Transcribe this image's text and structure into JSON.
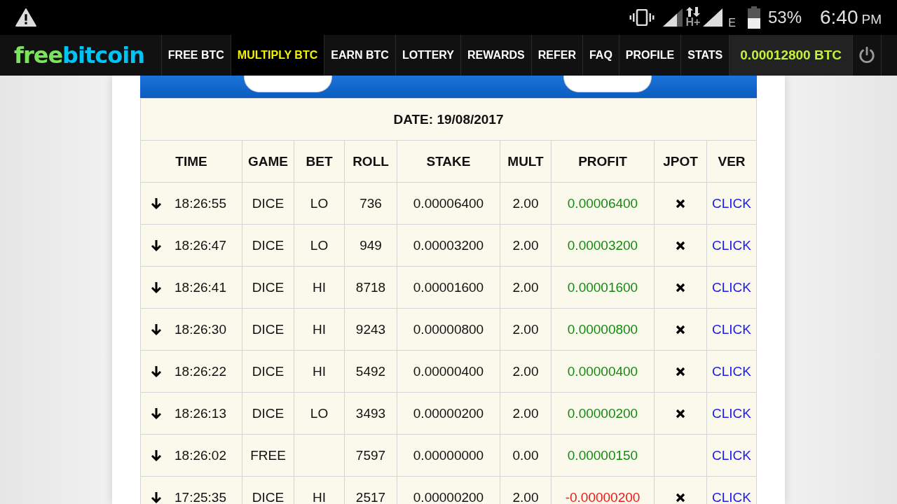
{
  "status_bar": {
    "network_1": "H+",
    "network_2": "E",
    "battery": "53%",
    "time": "6:40",
    "ampm": "PM"
  },
  "nav": {
    "logo_1": "free",
    "logo_2": "bitcoin",
    "items": [
      {
        "label": "FREE BTC",
        "selected": false
      },
      {
        "label": "MULTIPLY BTC",
        "selected": true
      },
      {
        "label": "EARN BTC",
        "selected": false
      },
      {
        "label": "LOTTERY",
        "selected": false
      },
      {
        "label": "REWARDS",
        "selected": false
      },
      {
        "label": "REFER",
        "selected": false
      },
      {
        "label": "FAQ",
        "selected": false
      },
      {
        "label": "PROFILE",
        "selected": false
      },
      {
        "label": "STATS",
        "selected": false
      }
    ],
    "balance": "0.00012800 BTC"
  },
  "table": {
    "date": "DATE: 19/08/2017",
    "columns": [
      "TIME",
      "GAME",
      "BET",
      "ROLL",
      "STAKE",
      "MULT",
      "PROFIT",
      "JPOT",
      "VER"
    ],
    "rows": [
      {
        "time": "18:26:55",
        "game": "DICE",
        "bet": "LO",
        "roll": "736",
        "stake": "0.00006400",
        "mult": "2.00",
        "profit": "0.00006400",
        "color": "#128a12",
        "jpot_x": true,
        "ver": "CLICK"
      },
      {
        "time": "18:26:47",
        "game": "DICE",
        "bet": "LO",
        "roll": "949",
        "stake": "0.00003200",
        "mult": "2.00",
        "profit": "0.00003200",
        "color": "#128a12",
        "jpot_x": true,
        "ver": "CLICK"
      },
      {
        "time": "18:26:41",
        "game": "DICE",
        "bet": "HI",
        "roll": "8718",
        "stake": "0.00001600",
        "mult": "2.00",
        "profit": "0.00001600",
        "color": "#128a12",
        "jpot_x": true,
        "ver": "CLICK"
      },
      {
        "time": "18:26:30",
        "game": "DICE",
        "bet": "HI",
        "roll": "9243",
        "stake": "0.00000800",
        "mult": "2.00",
        "profit": "0.00000800",
        "color": "#128a12",
        "jpot_x": true,
        "ver": "CLICK"
      },
      {
        "time": "18:26:22",
        "game": "DICE",
        "bet": "HI",
        "roll": "5492",
        "stake": "0.00000400",
        "mult": "2.00",
        "profit": "0.00000400",
        "color": "#128a12",
        "jpot_x": true,
        "ver": "CLICK"
      },
      {
        "time": "18:26:13",
        "game": "DICE",
        "bet": "LO",
        "roll": "3493",
        "stake": "0.00000200",
        "mult": "2.00",
        "profit": "0.00000200",
        "color": "#128a12",
        "jpot_x": true,
        "ver": "CLICK"
      },
      {
        "time": "18:26:02",
        "game": "FREE",
        "roll": "7597",
        "stake": "0.00000000",
        "mult": "0.00",
        "profit": "0.00000150",
        "color": "#128a12",
        "jpot_x": false,
        "ver": "CLICK"
      },
      {
        "time": "17:25:35",
        "game": "DICE",
        "bet": "HI",
        "roll": "2517",
        "stake": "0.00000200",
        "mult": "2.00",
        "profit": "-0.00000200",
        "color": "#f01818",
        "jpot_x": true,
        "ver": "CLICK"
      }
    ]
  }
}
